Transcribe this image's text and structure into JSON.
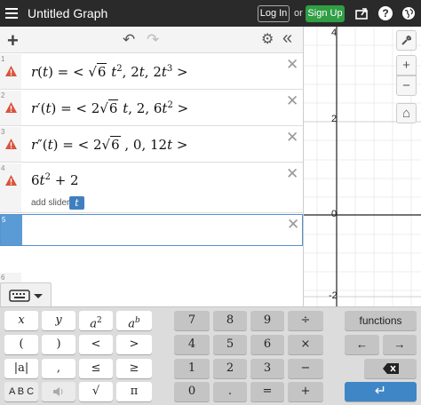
{
  "topbar": {
    "title": "Untitled Graph",
    "login": "Log In",
    "or": "or",
    "signup": "Sign Up",
    "help": "?"
  },
  "panel": {
    "add": "+",
    "undo": "↶",
    "redo": "↷",
    "settings": "⚙",
    "collapse": "«",
    "delete": "✕"
  },
  "expressions": [
    {
      "index": "1"
    },
    {
      "index": "2"
    },
    {
      "index": "3"
    },
    {
      "index": "4",
      "slider_label": "add slider:",
      "slider_var": "t"
    },
    {
      "index": "5"
    },
    {
      "index": "6"
    }
  ],
  "graph": {
    "y_ticks": [
      "4",
      "2",
      "0",
      "-2"
    ],
    "zoom_in": "+",
    "zoom_out": "−",
    "home": "⌂",
    "wrench": "🔧"
  },
  "keypad": {
    "abc": "A B C",
    "functions": "functions",
    "row1": [
      "x",
      "y",
      "7",
      "8",
      "9",
      "÷"
    ],
    "row2": [
      "(",
      ")",
      "<",
      ">",
      "4",
      "5",
      "6",
      "×"
    ],
    "row3": [
      "|a|",
      ",",
      "≤",
      "≥",
      "1",
      "2",
      "3",
      "−"
    ],
    "row4": [
      "√",
      "π",
      "0",
      ".",
      "=",
      "+"
    ],
    "left": "←",
    "right": "→",
    "enter": "↵"
  },
  "colors": {
    "topbar": "#2a2a2a",
    "signup": "#2f9e44",
    "warning": "#d9533b",
    "active": "#5b9bd5",
    "blue_key": "#3f86c7"
  }
}
